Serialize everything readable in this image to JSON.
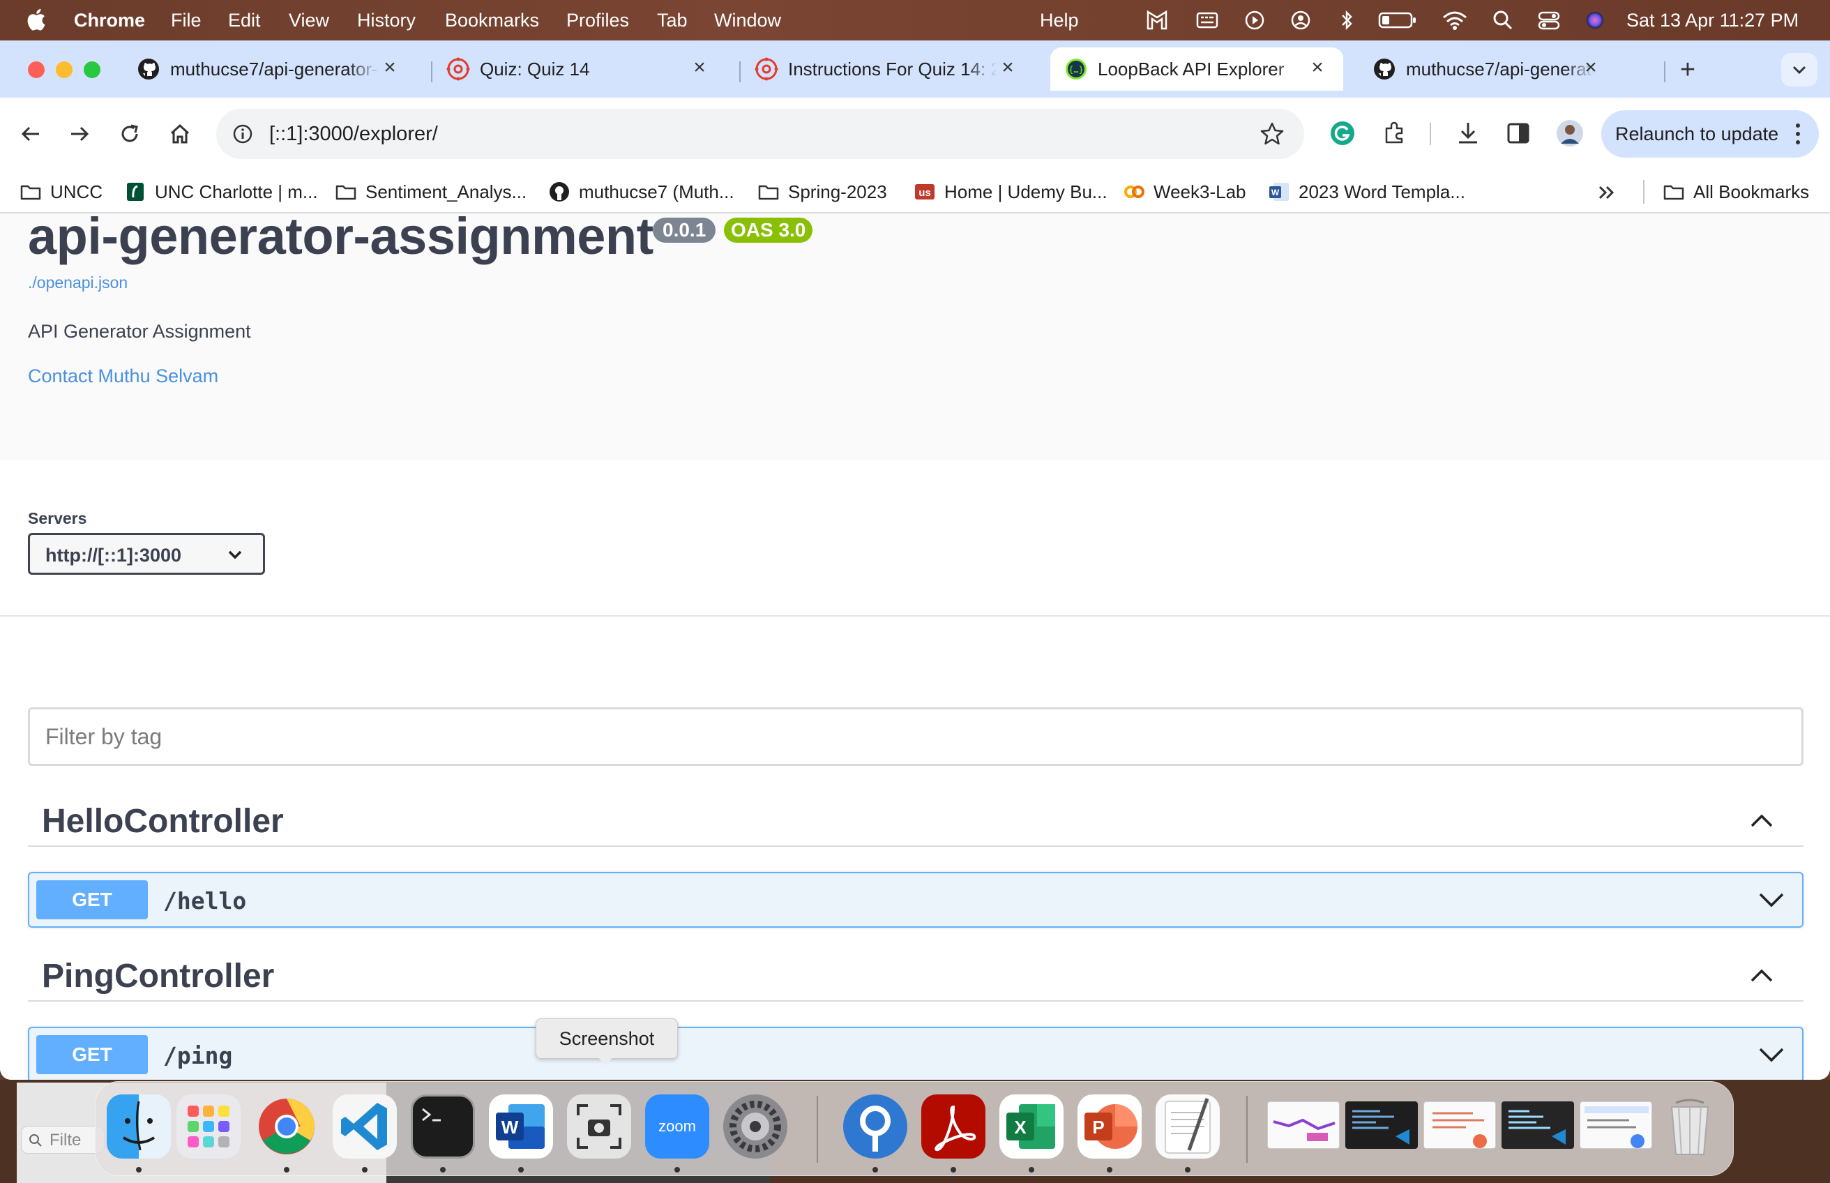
{
  "menubar": {
    "app": "Chrome",
    "items": [
      "File",
      "Edit",
      "View",
      "History",
      "Bookmarks",
      "Profiles",
      "Tab",
      "Window",
      "Help"
    ],
    "clock": "Sat 13 Apr  11:27 PM"
  },
  "tabs": [
    {
      "title": "muthucse7/api-generator-",
      "icon": "github-icon",
      "active": false
    },
    {
      "title": "Quiz: Quiz 14",
      "icon": "canvas-icon",
      "active": false
    },
    {
      "title": "Instructions For Quiz 14: 2",
      "icon": "canvas-icon",
      "active": false
    },
    {
      "title": "LoopBack API Explorer",
      "icon": "swagger-icon",
      "active": true
    },
    {
      "title": "muthucse7/api-generator-",
      "icon": "github-icon",
      "active": false
    }
  ],
  "omnibox": {
    "url": "[::1]:3000/explorer/"
  },
  "relaunch_label": "Relaunch to update",
  "bookmarks": [
    {
      "label": "UNCC",
      "icon": "folder-icon"
    },
    {
      "label": "UNC Charlotte | m...",
      "icon": "uncc-icon"
    },
    {
      "label": "Sentiment_Analys...",
      "icon": "folder-icon"
    },
    {
      "label": "muthucse7 (Muth...",
      "icon": "github-icon"
    },
    {
      "label": "Spring-2023",
      "icon": "folder-icon"
    },
    {
      "label": "Home | Udemy Bu...",
      "icon": "udemy-icon"
    },
    {
      "label": "Week3-Lab",
      "icon": "colab-icon"
    },
    {
      "label": "2023 Word Templa...",
      "icon": "word-icon"
    }
  ],
  "all_bookmarks_label": "All Bookmarks",
  "api": {
    "title": "api-generator-assignment",
    "version": "0.0.1",
    "oas": "OAS 3.0",
    "spec_link": "./openapi.json",
    "description": "API Generator Assignment",
    "contact": "Contact Muthu Selvam"
  },
  "servers": {
    "label": "Servers",
    "selected": "http://[::1]:3000"
  },
  "filter": {
    "placeholder": "Filter by tag"
  },
  "tags": [
    {
      "name": "HelloController",
      "operations": [
        {
          "method": "GET",
          "path": "/hello"
        }
      ]
    },
    {
      "name": "PingController",
      "operations": [
        {
          "method": "GET",
          "path": "/ping"
        }
      ]
    }
  ],
  "tooltip": "Screenshot",
  "desktop": {
    "search_placeholder": "Filte"
  },
  "dock": [
    "finder-icon",
    "launchpad-icon",
    "chrome-icon",
    "vscode-icon",
    "terminal-icon",
    "word-icon",
    "screenshot-icon",
    "zoom-icon",
    "settings-icon",
    "pgadmin-icon",
    "acrobat-icon",
    "excel-icon",
    "powerpoint-icon",
    "textedit-icon"
  ],
  "colors": {
    "get": "#61affe",
    "get_bg": "#ebf3fb",
    "oas": "#89bf04",
    "version": "#7d8492",
    "link": "#4990e2"
  }
}
